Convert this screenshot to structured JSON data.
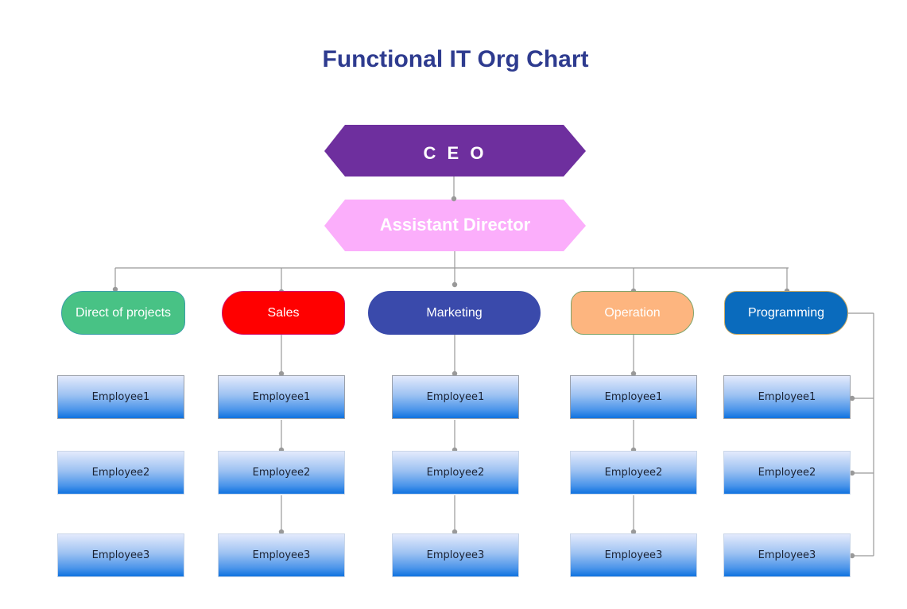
{
  "title": "Functional IT Org Chart",
  "ceo": {
    "label": "C E O",
    "color": "#6e2f9e"
  },
  "assistant": {
    "label": "Assistant Director",
    "color": "#fbaefb"
  },
  "connector_color": "#999999",
  "departments": [
    {
      "label": "Direct of projects",
      "color": "#48c285",
      "border": "#3a9ea8",
      "employees": [
        "Employee1",
        "Employee2",
        "Employee3"
      ]
    },
    {
      "label": "Sales",
      "color": "#ff0000",
      "border": "#d0106a",
      "employees": [
        "Employee1",
        "Employee2",
        "Employee3"
      ]
    },
    {
      "label": "Marketing",
      "color": "#3a4aab",
      "border": "#3a4aab",
      "employees": [
        "Employee1",
        "Employee2",
        "Employee3"
      ]
    },
    {
      "label": "Operation",
      "color": "#fdb57f",
      "border": "#7fa36a",
      "employees": [
        "Employee1",
        "Employee2",
        "Employee3"
      ]
    },
    {
      "label": "Programming",
      "color": "#0a6bbd",
      "border": "#c9a860",
      "employees": [
        "Employee1",
        "Employee2",
        "Employee3"
      ]
    }
  ]
}
